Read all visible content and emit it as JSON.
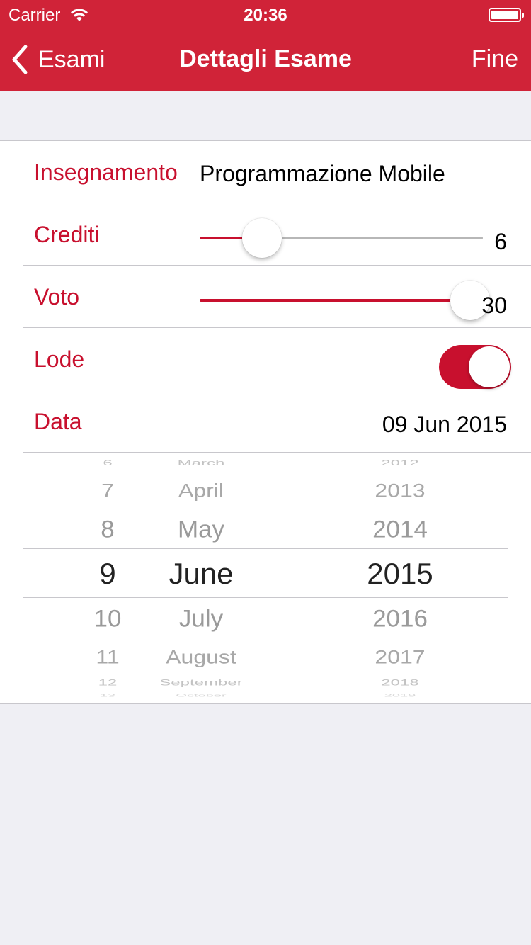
{
  "status_bar": {
    "carrier": "Carrier",
    "time": "20:36"
  },
  "nav": {
    "back_label": "Esami",
    "title": "Dettagli Esame",
    "done_label": "Fine",
    "color": "#d02338"
  },
  "form": {
    "subject": {
      "label": "Insegnamento",
      "value": "Programmazione Mobile"
    },
    "credits": {
      "label": "Crediti",
      "value": "6",
      "slider_fraction": 0.22
    },
    "grade": {
      "label": "Voto",
      "value": "30",
      "slider_fraction": 1.0
    },
    "honors": {
      "label": "Lode",
      "on": true
    },
    "date": {
      "label": "Data",
      "value": "09 Jun 2015"
    }
  },
  "picker": {
    "days": [
      "6",
      "7",
      "8",
      "9",
      "10",
      "11",
      "12",
      "13"
    ],
    "months": [
      "March",
      "April",
      "May",
      "June",
      "July",
      "August",
      "September",
      "October"
    ],
    "years": [
      "2012",
      "2013",
      "2014",
      "2015",
      "2016",
      "2017",
      "2018",
      "2019"
    ],
    "selected": {
      "day": "9",
      "month": "June",
      "year": "2015"
    }
  },
  "accent_color": "#c8102e"
}
